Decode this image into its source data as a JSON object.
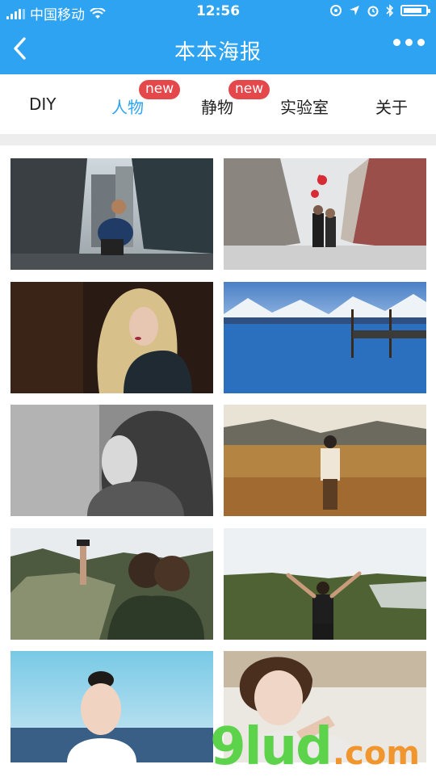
{
  "status_bar": {
    "carrier": "中国移动",
    "time": "12:56",
    "battery_level": 0.85
  },
  "nav": {
    "title": "本本海报",
    "back_icon": "chevron-left-icon",
    "more_icon": "more-dots-icon"
  },
  "tabs": [
    {
      "label": "DIY",
      "badge": ""
    },
    {
      "label": "人物",
      "badge": "new"
    },
    {
      "label": "静物",
      "badge": "new"
    },
    {
      "label": "实验室",
      "badge": ""
    },
    {
      "label": "关于",
      "badge": ""
    }
  ],
  "active_tab": "人物",
  "colors": {
    "nav_bg": "#2ea3f2",
    "active_tab": "#2ea3f2",
    "badge": "#e4484b"
  },
  "poster_tiles": [
    {
      "subject": "city-skater"
    },
    {
      "subject": "couple-street-heart-balloons"
    },
    {
      "subject": "blonde-woman-portrait"
    },
    {
      "subject": "lake-mountains-pier"
    },
    {
      "subject": "bw-woman-scarf"
    },
    {
      "subject": "woman-in-field"
    },
    {
      "subject": "friends-selfie-canyon"
    },
    {
      "subject": "arms-raised-canyon"
    },
    {
      "subject": "girl-blue-sky"
    },
    {
      "subject": "young-man-portrait"
    }
  ],
  "watermark": {
    "number": "9lud",
    "suffix": ".com"
  }
}
